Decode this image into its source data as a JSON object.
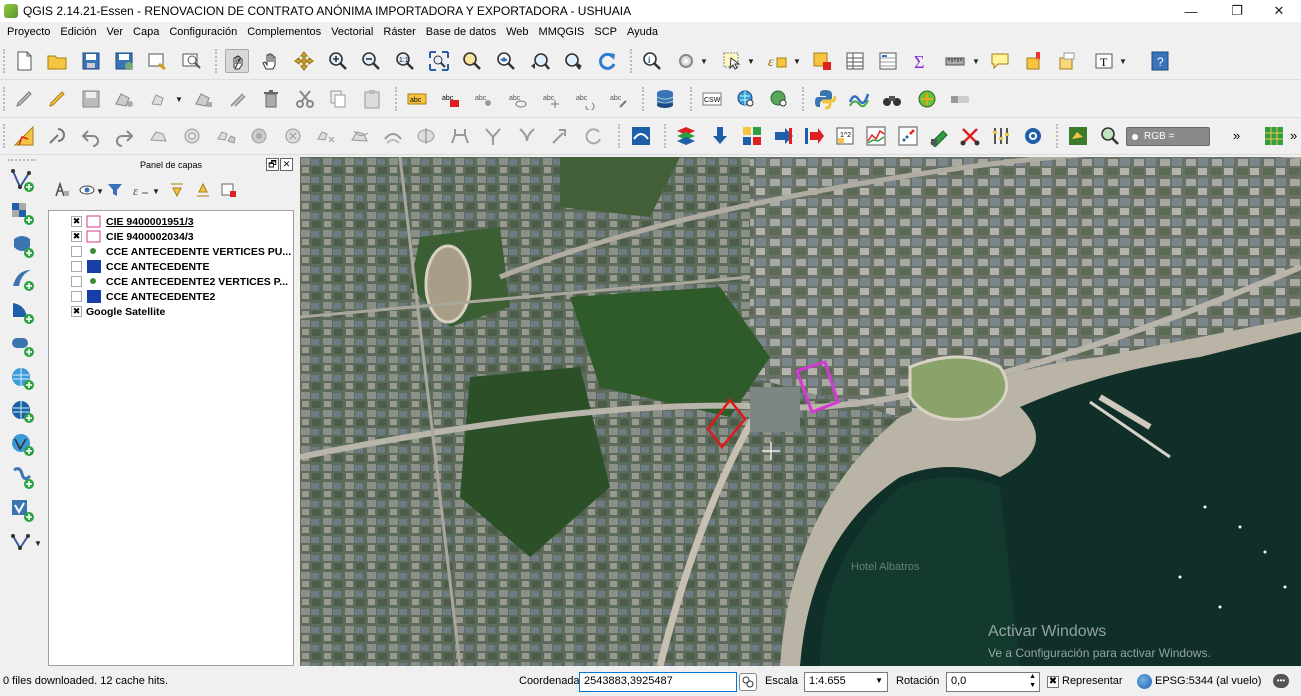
{
  "window": {
    "title": "QGIS 2.14.21-Essen - RENOVACION DE CONTRATO ANÓNIMA IMPORTADORA Y EXPORTADORA - USHUAIA",
    "minimize": "—",
    "maximize": "❐",
    "close": "✕"
  },
  "menu": [
    "Proyecto",
    "Edición",
    "Ver",
    "Capa",
    "Configuración",
    "Complementos",
    "Vectorial",
    "Ráster",
    "Base de datos",
    "Web",
    "MMQGIS",
    "SCP",
    "Ayuda"
  ],
  "toolbar3": {
    "rgb_label": "RGB =",
    "overflow": "»"
  },
  "panel": {
    "title": "Panel de capas",
    "float": "🗗",
    "close": "✕"
  },
  "layers": [
    {
      "name": "CIE 9400001951/3",
      "checked": true,
      "symbol": "pink-outline",
      "underline": true
    },
    {
      "name": "CIE 9400002034/3",
      "checked": true,
      "symbol": "pink-outline",
      "underline": false
    },
    {
      "name": "CCE ANTECEDENTE VERTICES PU...",
      "checked": false,
      "symbol": "green-point",
      "underline": false
    },
    {
      "name": "CCE ANTECEDENTE",
      "checked": false,
      "symbol": "blue-fill",
      "underline": false
    },
    {
      "name": "CCE ANTECEDENTE2 VERTICES P...",
      "checked": false,
      "symbol": "green-point",
      "underline": false
    },
    {
      "name": "CCE ANTECEDENTE2",
      "checked": false,
      "symbol": "blue-fill",
      "underline": false
    },
    {
      "name": "Google Satellite",
      "checked": true,
      "symbol": "none",
      "underline": false
    }
  ],
  "map": {
    "watermark_title": "Activar Windows",
    "watermark_sub": "Ve a Configuración para activar Windows.",
    "faint_label": "Hotel Albatros"
  },
  "status": {
    "message": "0 files downloaded. 12 cache hits.",
    "coord_label": "Coordenada",
    "coord_value": "2543883,3925487",
    "scale_label": "Escala",
    "scale_value": "1:4.655",
    "rotation_label": "Rotación",
    "rotation_value": "0,0",
    "render_label": "Representar",
    "crs": "EPSG:5344 (al vuelo)"
  },
  "colors": {
    "highlight_parcel": "#e01a1a",
    "selected_parcel": "#d63ad6",
    "qgis_green": "#589632"
  }
}
